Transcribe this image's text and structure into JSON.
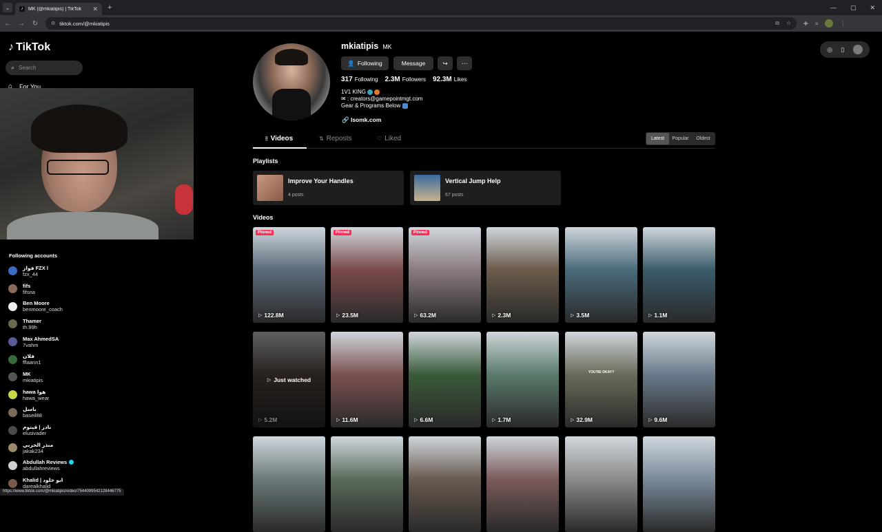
{
  "browser": {
    "tab_title": "MK (@mkiatipis) | TikTok",
    "url": "tiktok.com/@mkiatipis",
    "status_url": "https://www.tiktok.com/@mkiatipis/video/7544099542128446775"
  },
  "sidebar": {
    "logo_text": "TikTok",
    "search_placeholder": "Search",
    "for_you_label": "For You",
    "following_title": "Following accounts",
    "accounts": [
      {
        "name": "فواز FZX l",
        "handle": "fzx_44",
        "color": "#3b6bc4"
      },
      {
        "name": "fifs",
        "handle": "fifsna",
        "color": "#8a6a5a"
      },
      {
        "name": "Ben Moore",
        "handle": "benmoore_coach",
        "color": "#eeeeee"
      },
      {
        "name": "Thamer",
        "handle": "th.99h",
        "color": "#6a6a4a"
      },
      {
        "name": "Max AhmedSA",
        "handle": "7vahm",
        "color": "#5a5a9a"
      },
      {
        "name": "فلان",
        "handle": "fflaann1",
        "color": "#3a6a3a"
      },
      {
        "name": "MK",
        "handle": "mkiatipis",
        "color": "#555555"
      },
      {
        "name": "hawa هوا",
        "handle": "hawa_wear",
        "color": "#c8d64a"
      },
      {
        "name": "باسل",
        "handle": "baseil88",
        "color": "#7a6a5a"
      },
      {
        "name": "نادر | قيتوم",
        "handle": "elusivader",
        "color": "#4a4a4a"
      },
      {
        "name": "منذر الحربي",
        "handle": "jakak234",
        "color": "#9a8a6a"
      },
      {
        "name": "Abdullah Reviews",
        "handle": "abdullahreviews",
        "color": "#cfcfcf",
        "verified": true
      },
      {
        "name": "Khalid | ابو خلود",
        "handle": "darealkhalid",
        "color": "#7a5a4a"
      }
    ]
  },
  "profile": {
    "username": "mkiatipis",
    "nickname": "MK",
    "following_btn": "Following",
    "message_btn": "Message",
    "stats": [
      {
        "value": "317",
        "label": "Following"
      },
      {
        "value": "2.3M",
        "label": "Followers"
      },
      {
        "value": "92.3M",
        "label": "Likes"
      }
    ],
    "bio_line1": "1V1 KING",
    "bio_line2": ": creators@gamepointmgt.com",
    "bio_line3": "Gear & Programs Below",
    "link": "lsomk.com"
  },
  "tabs": {
    "videos": "Videos",
    "reposts": "Reposts",
    "liked": "Liked"
  },
  "sort": {
    "latest": "Latest",
    "popular": "Popular",
    "oldest": "Oldest"
  },
  "playlists_title": "Playlists",
  "playlists": [
    {
      "name": "Improve Your Handles",
      "count": "4 posts"
    },
    {
      "name": "Vertical Jump Help",
      "count": "67 posts"
    }
  ],
  "videos_title": "Videos",
  "video_badges": {
    "pinned": "Pinned",
    "just_watched": "Just watched",
    "youre_okay": "YOU'RE OKAY?"
  },
  "videos": [
    {
      "views": "122.8M",
      "pinned": true,
      "bg": "#5a6a7a"
    },
    {
      "views": "23.5M",
      "pinned": true,
      "bg": "#7a4a4a"
    },
    {
      "views": "63.2M",
      "pinned": true,
      "bg": "#8a7a80"
    },
    {
      "views": "2.3M",
      "bg": "#6a5a4a"
    },
    {
      "views": "3.5M",
      "bg": "#4a6a7a"
    },
    {
      "views": "1.1M",
      "bg": "#3a5a6a"
    },
    {
      "views": "5.2M",
      "watched": true,
      "bg": "#5a4a40"
    },
    {
      "views": "11.6M",
      "bg": "#7a5050"
    },
    {
      "views": "6.6M",
      "bg": "#3a5a3a"
    },
    {
      "views": "1.7M",
      "bg": "#5a7a6a"
    },
    {
      "views": "32.9M",
      "bg": "#6a6a5a"
    },
    {
      "views": "9.6M",
      "bg": "#6a7a8a"
    },
    {
      "bg": "#6a7a7a"
    },
    {
      "bg": "#5a6a5a"
    },
    {
      "bg": "#6a5a50"
    },
    {
      "bg": "#7a5a5a"
    },
    {
      "bg": "#8a8a8a"
    },
    {
      "bg": "#7a8a9a"
    }
  ]
}
